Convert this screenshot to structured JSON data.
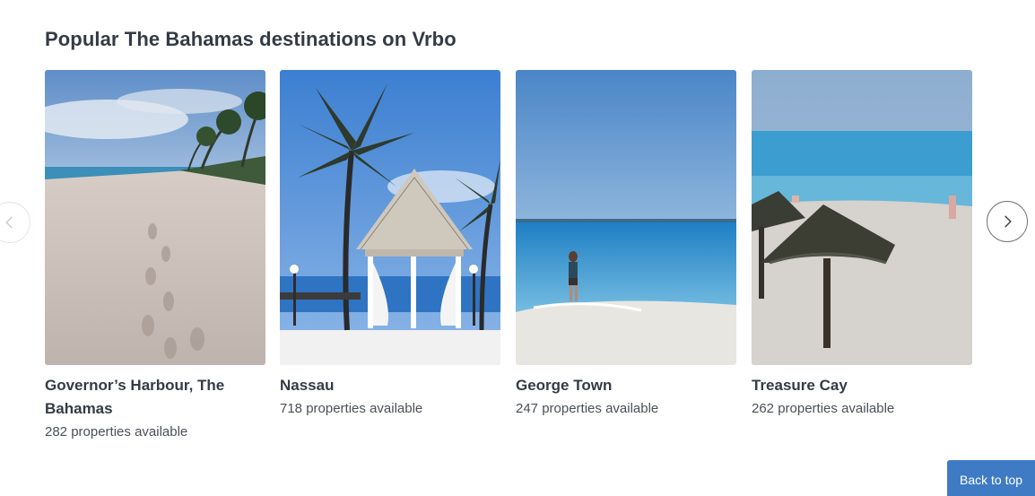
{
  "section": {
    "title": "Popular The Bahamas destinations on Vrbo"
  },
  "destinations": [
    {
      "name": "Governor’s Harbour, The Bahamas",
      "count": "282 properties available"
    },
    {
      "name": "Nassau",
      "count": "718 properties available"
    },
    {
      "name": "George Town",
      "count": "247 properties available"
    },
    {
      "name": "Treasure Cay",
      "count": "262 properties available"
    }
  ],
  "carousel": {
    "prev_icon": "chevron-left-icon",
    "next_icon": "chevron-right-icon"
  },
  "back_to_top": {
    "label": "Back to top"
  },
  "colors": {
    "heading": "#343b45",
    "accent": "#3f7bc4",
    "sky": "#4a86c8",
    "sand": "#d9d4cc"
  }
}
